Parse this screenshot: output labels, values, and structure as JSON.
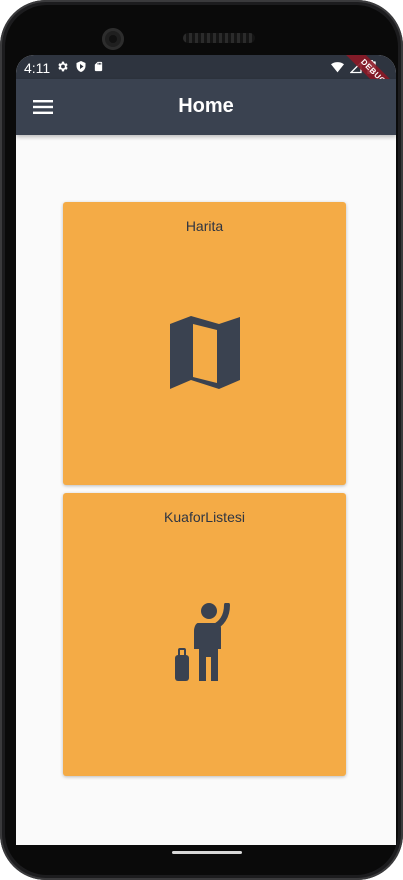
{
  "statusbar": {
    "time": "4:11"
  },
  "appbar": {
    "title": "Home",
    "debug_banner": "DEBUG"
  },
  "cards": [
    {
      "label": "Harita",
      "icon": "map-icon"
    },
    {
      "label": "KuaforListesi",
      "icon": "person-with-luggage-icon"
    }
  ],
  "colors": {
    "appbar": "#3a4250",
    "statusbar": "#2e343f",
    "card": "#f4ab46",
    "icon": "#3a4250",
    "background": "#fafafa"
  }
}
